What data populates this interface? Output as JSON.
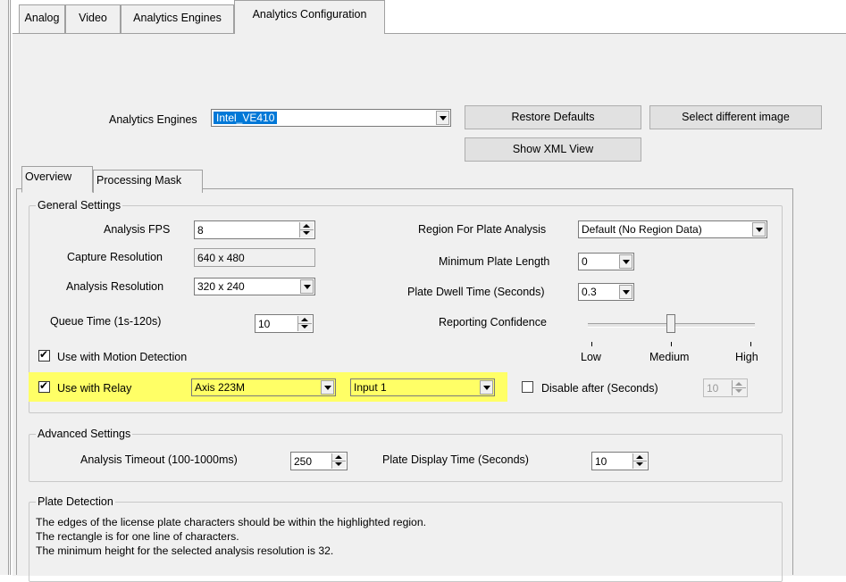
{
  "top_tabs": [
    "Analog",
    "Video",
    "Analytics Engines",
    "Analytics Configuration"
  ],
  "engine": {
    "label": "Analytics Engines",
    "selected": "Intel_VE410",
    "restore_label": "Restore Defaults",
    "select_image_label": "Select different image",
    "xml_label": "Show XML View"
  },
  "inner_tabs": [
    "Overview",
    "Processing Mask"
  ],
  "general": {
    "title": "General Settings",
    "fps_label": "Analysis FPS",
    "fps_value": "8",
    "capture_label": "Capture Resolution",
    "capture_value": "640 x 480",
    "analysis_res_label": "Analysis Resolution",
    "analysis_res_value": "320 x 240",
    "queue_label": "Queue Time (1s-120s)",
    "queue_value": "10",
    "region_label": "Region For Plate Analysis",
    "region_value": "Default (No Region Data)",
    "min_plate_label": "Minimum Plate Length",
    "min_plate_value": "0",
    "dwell_label": "Plate Dwell Time (Seconds)",
    "dwell_value": "0.3",
    "confidence_label": "Reporting Confidence",
    "confidence_ticks": [
      "Low",
      "Medium",
      "High"
    ],
    "confidence_level": 0.5,
    "motion_label": "Use with Motion Detection",
    "motion_checked": true,
    "relay_label": "Use with Relay",
    "relay_checked": true,
    "relay_device": "Axis 223M",
    "relay_input": "Input 1",
    "disable_label": "Disable after (Seconds)",
    "disable_checked": false,
    "disable_value": "10"
  },
  "advanced": {
    "title": "Advanced Settings",
    "timeout_label": "Analysis Timeout (100-1000ms)",
    "timeout_value": "250",
    "display_label": "Plate Display Time (Seconds)",
    "display_value": "10"
  },
  "plate": {
    "title": "Plate Detection",
    "lines": [
      "The edges of the license plate characters should be within the highlighted region.",
      "The rectangle is for one line of characters.",
      "The minimum height for the selected analysis resolution is 32."
    ]
  },
  "colors": {
    "highlight": "#ffff66",
    "selection": "#0078d7"
  }
}
